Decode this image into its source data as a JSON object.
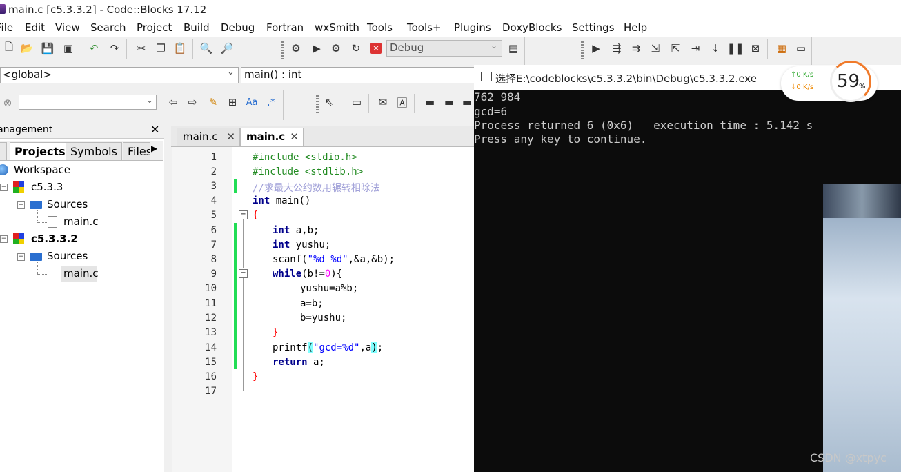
{
  "window": {
    "title": "main.c [c5.3.3.2] - Code::Blocks 17.12"
  },
  "menu": [
    "File",
    "Edit",
    "View",
    "Search",
    "Project",
    "Build",
    "Debug",
    "Fortran",
    "wxSmith",
    "Tools",
    "Tools+",
    "Plugins",
    "DoxyBlocks",
    "Settings",
    "Help"
  ],
  "toolbar": {
    "build_target": "Debug"
  },
  "scope": {
    "global": "<global>",
    "function": "main() : int"
  },
  "search": {
    "value": ""
  },
  "management": {
    "title": "Management",
    "tabs": [
      "Projects",
      "Symbols",
      "Files"
    ],
    "tree": {
      "workspace": "Workspace",
      "project1": "c5.3.3",
      "sources1": "Sources",
      "file1": "main.c",
      "project2": "c5.3.3.2",
      "sources2": "Sources",
      "file2": "main.c"
    }
  },
  "editor": {
    "tabs": [
      "main.c",
      "main.c"
    ],
    "line_numbers": [
      "1",
      "2",
      "3",
      "4",
      "5",
      "6",
      "7",
      "8",
      "9",
      "10",
      "11",
      "12",
      "13",
      "14",
      "15",
      "16",
      "17"
    ]
  },
  "code": {
    "l1": "#include <stdio.h>",
    "l2": "#include <stdlib.h>",
    "l3": "//求最大公约数用辗转相除法",
    "l4_kw": "int",
    "l4_rest": " main()",
    "l5": "{",
    "l6_kw": "int",
    "l6_rest": " a,b;",
    "l7_kw": "int",
    "l7_rest": " yushu;",
    "l8_a": "scanf(",
    "l8_str": "\"%d %d\"",
    "l8_b": ",&a,&b);",
    "l9_kw": "while",
    "l9_a": "(b!=",
    "l9_num": "0",
    "l9_b": "){",
    "l10": "yushu=a%b;",
    "l11": "a=b;",
    "l12": "b=yushu;",
    "l13": "}",
    "l14_a": "printf",
    "l14_p1": "(",
    "l14_str": "\"gcd=%d\"",
    "l14_b": ",a",
    "l14_p2": ")",
    "l14_c": ";",
    "l15_kw": "return",
    "l15_rest": " a;",
    "l16": "}"
  },
  "console": {
    "title": "选择E:\\codeblocks\\c5.3.3.2\\bin\\Debug\\c5.3.3.2.exe",
    "lines": [
      "762 984",
      "gcd=6",
      "Process returned 6 (0x6)   execution time : 5.142 s",
      "Press any key to continue."
    ]
  },
  "netspeed": {
    "up": "↑0   K/s",
    "down": "↓0   K/s",
    "cpu": "59",
    "cpu_unit": "%"
  },
  "watermark": "CSDN @xtpyc",
  "colors": {
    "change_bar": "#22dd55",
    "cpu_ring": "#f07a2a",
    "console_bg": "#0c0c0c"
  }
}
